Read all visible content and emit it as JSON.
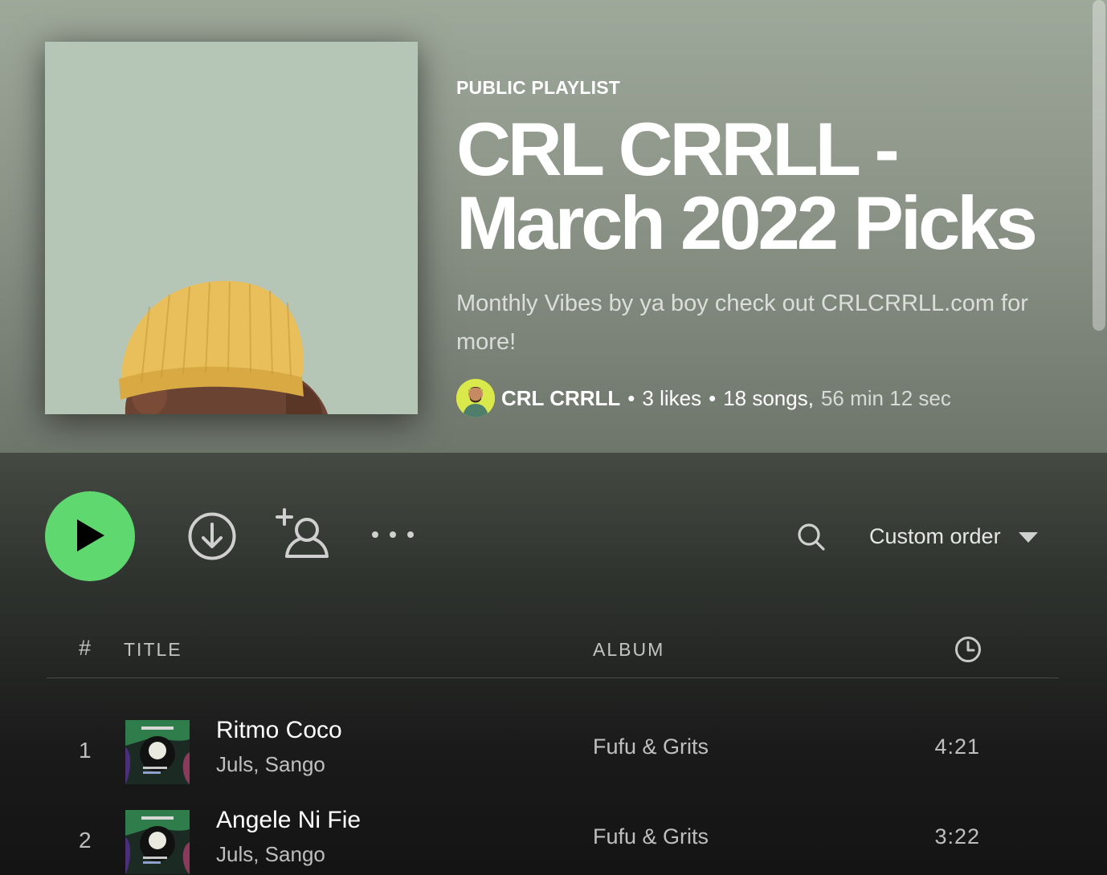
{
  "header": {
    "type_label": "PUBLIC PLAYLIST",
    "title": "CRL CRRLL -\nMarch 2022 Picks",
    "description": "Monthly Vibes by ya boy check out CRLCRRLL.com for more!",
    "owner": "CRL CRRLL",
    "separator": "•",
    "likes": "3 likes",
    "songs": "18 songs",
    "comma": ",",
    "duration": "56 min 12 sec"
  },
  "actions": {
    "play_icon": "play-icon",
    "download_icon": "download-icon",
    "add_user_icon": "add-user-icon",
    "more_icon": "more-icon",
    "search_icon": "search-icon",
    "sort_label": "Custom order",
    "sort_icon": "caret-down-icon"
  },
  "table": {
    "headers": {
      "number": "#",
      "title": "TITLE",
      "album": "ALBUM",
      "duration_icon": "clock-icon"
    },
    "tracks": [
      {
        "number": "1",
        "title": "Ritmo Coco",
        "artists": "Juls, Sango",
        "album": "Fufu & Grits",
        "duration": "4:21"
      },
      {
        "number": "2",
        "title": "Angele Ni Fie",
        "artists": "Juls, Sango",
        "album": "Fufu & Grits",
        "duration": "3:22"
      }
    ]
  },
  "colors": {
    "play_button": "#5fd86f",
    "header_top": "#9ea99a",
    "header_bottom": "#6e756b",
    "cover_background": "#b5c5b6",
    "beanie": "#e9bf5c",
    "avatar_background": "#d9e84a"
  }
}
